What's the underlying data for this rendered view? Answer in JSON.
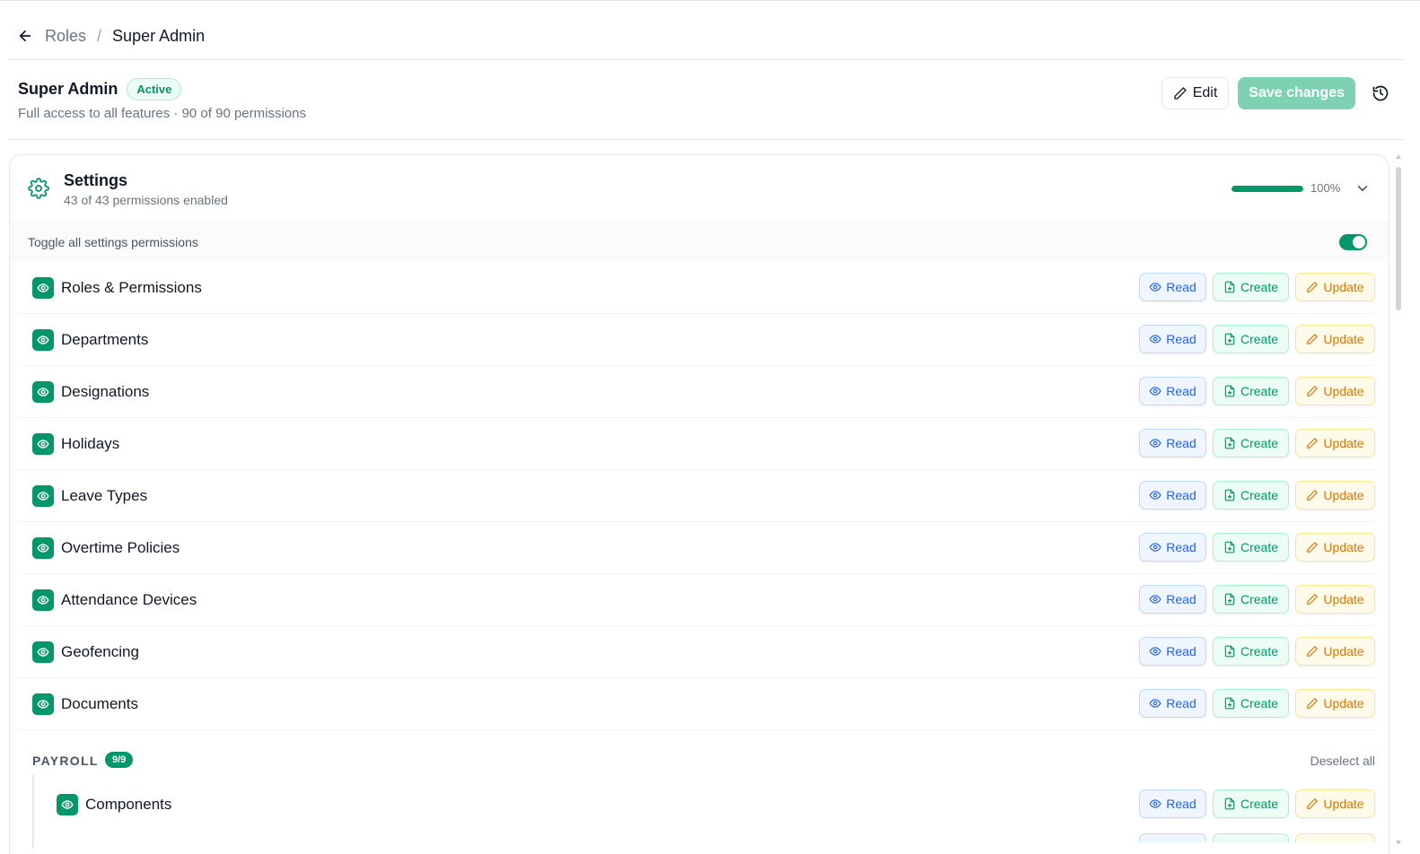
{
  "breadcrumb": {
    "parent": "Roles",
    "separator": "/",
    "current": "Super Admin"
  },
  "role": {
    "name": "Super Admin",
    "status": "Active",
    "description": "Full access to all features · 90 of 90 permissions"
  },
  "actions": {
    "edit_label": "Edit",
    "save_label": "Save changes"
  },
  "section": {
    "title": "Settings",
    "subtitle": "43 of 43 permissions enabled",
    "progress_percent": 100,
    "progress_label": "100%",
    "toggle_all_label": "Toggle all settings permissions",
    "toggle_all_on": true
  },
  "permission_buttons": {
    "read": "Read",
    "create": "Create",
    "update": "Update"
  },
  "permissions": [
    {
      "label": "Roles & Permissions",
      "checked": true
    },
    {
      "label": "Departments",
      "checked": true
    },
    {
      "label": "Designations",
      "checked": true
    },
    {
      "label": "Holidays",
      "checked": true
    },
    {
      "label": "Leave Types",
      "checked": true
    },
    {
      "label": "Overtime Policies",
      "checked": true
    },
    {
      "label": "Attendance Devices",
      "checked": true
    },
    {
      "label": "Geofencing",
      "checked": true
    },
    {
      "label": "Documents",
      "checked": true
    }
  ],
  "group": {
    "title": "PAYROLL",
    "count": "9/9",
    "deselect_label": "Deselect all",
    "items": [
      {
        "label": "Components",
        "checked": true
      }
    ]
  },
  "colors": {
    "accent": "#059669",
    "save_disabled": "#7fd1b4",
    "read": "#2563eb",
    "create": "#059669",
    "update": "#d97706"
  },
  "icons": {
    "back": "arrow-left-icon",
    "edit": "pencil-icon",
    "history": "history-icon",
    "section": "gear-icon",
    "expand": "chevron-down-icon",
    "check": "eye-check-icon",
    "read": "eye-icon",
    "create": "file-plus-icon",
    "update": "pencil-icon"
  }
}
